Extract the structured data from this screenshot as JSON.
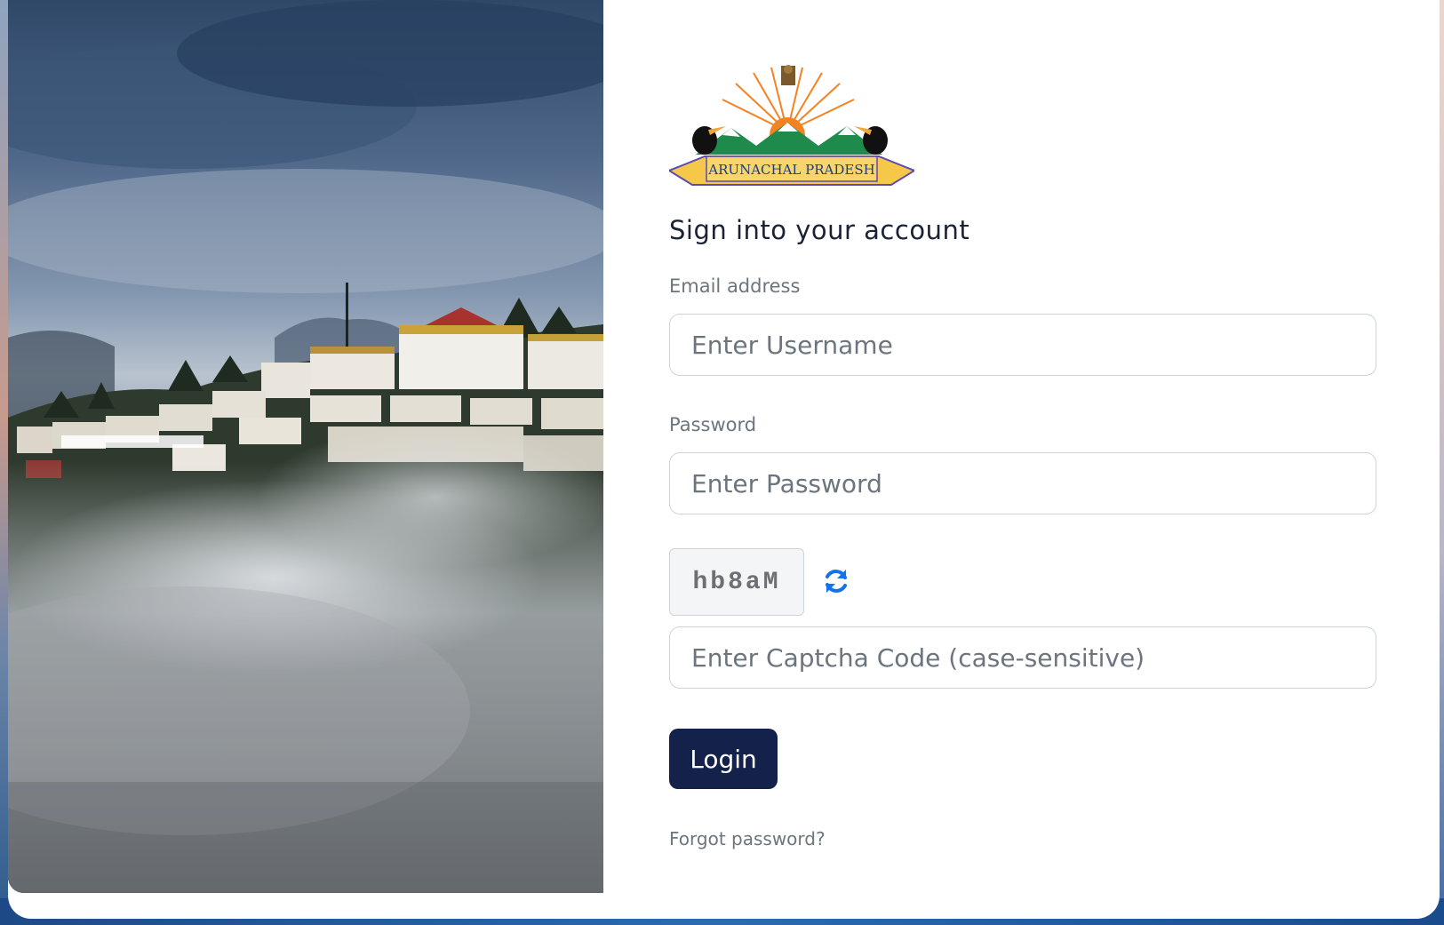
{
  "logo": {
    "text": "ARUNACHAL PRADESH",
    "emblem_icon": "ashoka-emblem-icon",
    "colors": {
      "sun": "#f58220",
      "mountain": "#1e8a4c",
      "ribbon": "#f6c84a",
      "ribbon_edge": "#5b4bb3"
    }
  },
  "form": {
    "title": "Sign into your account",
    "email_label": "Email address",
    "username_placeholder": "Enter Username",
    "password_label": "Password",
    "password_placeholder": "Enter Password",
    "captcha_code": "hb8aM",
    "refresh_icon": "refresh-icon",
    "captcha_placeholder": "Enter Captcha Code (case-sensitive)",
    "login_label": "Login",
    "forgot_label": "Forgot password?"
  },
  "colors": {
    "primary_button": "#14214a",
    "refresh_icon": "#1273eb",
    "label_text": "#6c757d",
    "border": "#ced4da"
  }
}
